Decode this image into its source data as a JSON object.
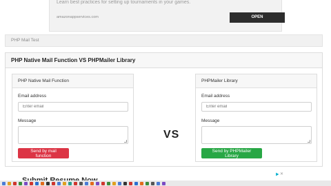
{
  "ad_top": {
    "text": "Learn best practices for setting up tournaments in your games.",
    "url": "amazonappservices.com",
    "open_label": "OPEN"
  },
  "breadcrumb": {
    "label": "PHP Mail Test"
  },
  "main": {
    "title": "PHP Native Mail Function VS PHPMailer Library",
    "vs": "VS",
    "left_panel": {
      "title": "PHP Native Mail Function",
      "email_label": "Email address",
      "email_placeholder": "Enter email",
      "message_label": "Message",
      "button_label": "Send by mail function"
    },
    "right_panel": {
      "title": "PHPMailer Library",
      "email_label": "Email address",
      "email_placeholder": "Enter email",
      "message_label": "Message",
      "button_label": "Send by PHPMailer Library"
    }
  },
  "bottom_ad": {
    "text": "Submit Resume Now",
    "close": "✕"
  },
  "colors": {
    "danger": "#dc3545",
    "success": "#28a745",
    "ad_button": "#2d2d2d"
  },
  "taskbar": {
    "icons": [
      "#4a7bd6",
      "#e0a020",
      "#d0352d",
      "#3b8d3b",
      "#7a4bc4",
      "#d0352d",
      "#2a6fd1",
      "#e36b1c",
      "#333333",
      "#d0352d",
      "#4a7bd6",
      "#e0a020",
      "#2a9d8f",
      "#d0352d",
      "#555555",
      "#4a7bd6",
      "#e36b1c",
      "#7a4bc4",
      "#d0352d",
      "#3b8d3b",
      "#e0a020",
      "#4a7bd6",
      "#333333",
      "#d0352d",
      "#2a6fd1",
      "#e36b1c",
      "#3b8d3b",
      "#555555",
      "#4a7bd6",
      "#7a4bc4"
    ]
  }
}
